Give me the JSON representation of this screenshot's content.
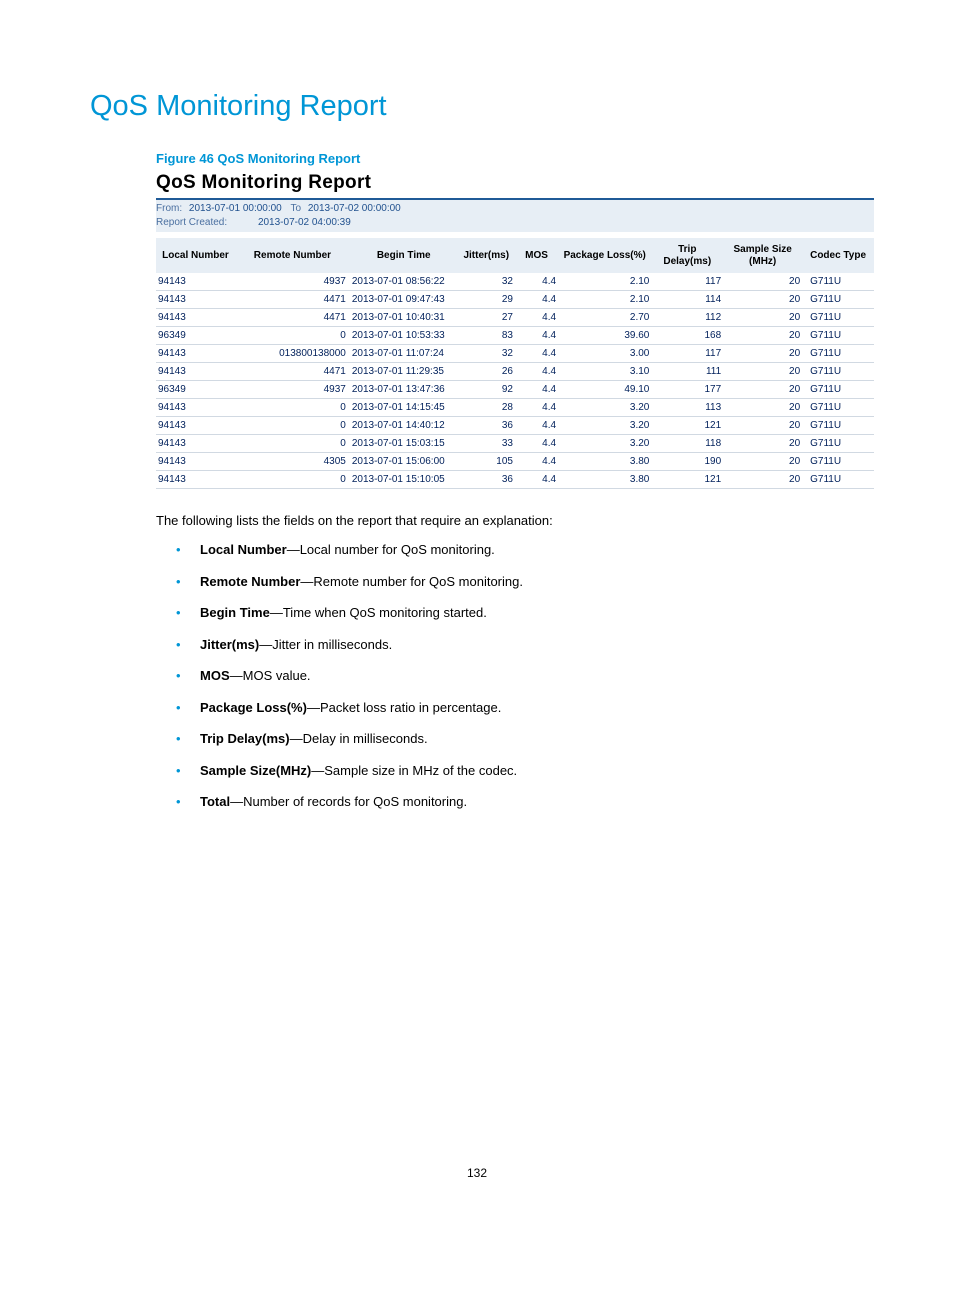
{
  "page": {
    "title": "QoS Monitoring Report",
    "figure_caption": "Figure 46 QoS Monitoring Report",
    "number": "132"
  },
  "report": {
    "title": "QoS Monitoring Report",
    "from_label": "From:",
    "from_value": "2013-07-01 00:00:00",
    "to_label": "To",
    "to_value": "2013-07-02 00:00:00",
    "created_label": "Report Created:",
    "created_value": "2013-07-02 04:00:39",
    "headers": {
      "local_number": "Local Number",
      "remote_number": "Remote Number",
      "begin_time": "Begin Time",
      "jitter": "Jitter(ms)",
      "mos": "MOS",
      "pkg_loss": "Package Loss(%)",
      "trip_delay": "Trip Delay(ms)",
      "sample_size": "Sample Size (MHz)",
      "codec": "Codec Type"
    },
    "rows": [
      {
        "ln": "94143",
        "rn": "4937",
        "bt": "2013-07-01 08:56:22",
        "jit": "32",
        "mos": "4.4",
        "pl": "2.10",
        "td": "117",
        "ss": "20",
        "ct": "G711U"
      },
      {
        "ln": "94143",
        "rn": "4471",
        "bt": "2013-07-01 09:47:43",
        "jit": "29",
        "mos": "4.4",
        "pl": "2.10",
        "td": "114",
        "ss": "20",
        "ct": "G711U"
      },
      {
        "ln": "94143",
        "rn": "4471",
        "bt": "2013-07-01 10:40:31",
        "jit": "27",
        "mos": "4.4",
        "pl": "2.70",
        "td": "112",
        "ss": "20",
        "ct": "G711U"
      },
      {
        "ln": "96349",
        "rn": "0",
        "bt": "2013-07-01 10:53:33",
        "jit": "83",
        "mos": "4.4",
        "pl": "39.60",
        "td": "168",
        "ss": "20",
        "ct": "G711U"
      },
      {
        "ln": "94143",
        "rn": "013800138000",
        "bt": "2013-07-01 11:07:24",
        "jit": "32",
        "mos": "4.4",
        "pl": "3.00",
        "td": "117",
        "ss": "20",
        "ct": "G711U"
      },
      {
        "ln": "94143",
        "rn": "4471",
        "bt": "2013-07-01 11:29:35",
        "jit": "26",
        "mos": "4.4",
        "pl": "3.10",
        "td": "111",
        "ss": "20",
        "ct": "G711U"
      },
      {
        "ln": "96349",
        "rn": "4937",
        "bt": "2013-07-01 13:47:36",
        "jit": "92",
        "mos": "4.4",
        "pl": "49.10",
        "td": "177",
        "ss": "20",
        "ct": "G711U"
      },
      {
        "ln": "94143",
        "rn": "0",
        "bt": "2013-07-01 14:15:45",
        "jit": "28",
        "mos": "4.4",
        "pl": "3.20",
        "td": "113",
        "ss": "20",
        "ct": "G711U"
      },
      {
        "ln": "94143",
        "rn": "0",
        "bt": "2013-07-01 14:40:12",
        "jit": "36",
        "mos": "4.4",
        "pl": "3.20",
        "td": "121",
        "ss": "20",
        "ct": "G711U"
      },
      {
        "ln": "94143",
        "rn": "0",
        "bt": "2013-07-01 15:03:15",
        "jit": "33",
        "mos": "4.4",
        "pl": "3.20",
        "td": "118",
        "ss": "20",
        "ct": "G711U"
      },
      {
        "ln": "94143",
        "rn": "4305",
        "bt": "2013-07-01 15:06:00",
        "jit": "105",
        "mos": "4.4",
        "pl": "3.80",
        "td": "190",
        "ss": "20",
        "ct": "G711U"
      },
      {
        "ln": "94143",
        "rn": "0",
        "bt": "2013-07-01 15:10:05",
        "jit": "36",
        "mos": "4.4",
        "pl": "3.80",
        "td": "121",
        "ss": "20",
        "ct": "G711U"
      }
    ]
  },
  "explain": {
    "intro": "The following lists the fields on the report that require an explanation:",
    "items": [
      {
        "term": "Local Number",
        "desc": "—Local number for QoS monitoring."
      },
      {
        "term": "Remote Number",
        "desc": "—Remote number for QoS monitoring."
      },
      {
        "term": "Begin Time",
        "desc": "—Time when QoS monitoring started."
      },
      {
        "term": "Jitter(ms)",
        "desc": "—Jitter in milliseconds."
      },
      {
        "term": "MOS",
        "desc": "—MOS value."
      },
      {
        "term": "Package Loss(%)",
        "desc": "—Packet loss ratio in percentage."
      },
      {
        "term": "Trip Delay(ms)",
        "desc": "—Delay in milliseconds."
      },
      {
        "term": "Sample Size(MHz)",
        "desc": "—Sample size in MHz of the codec."
      },
      {
        "term": "Total",
        "desc": "—Number of records for QoS monitoring."
      }
    ]
  }
}
